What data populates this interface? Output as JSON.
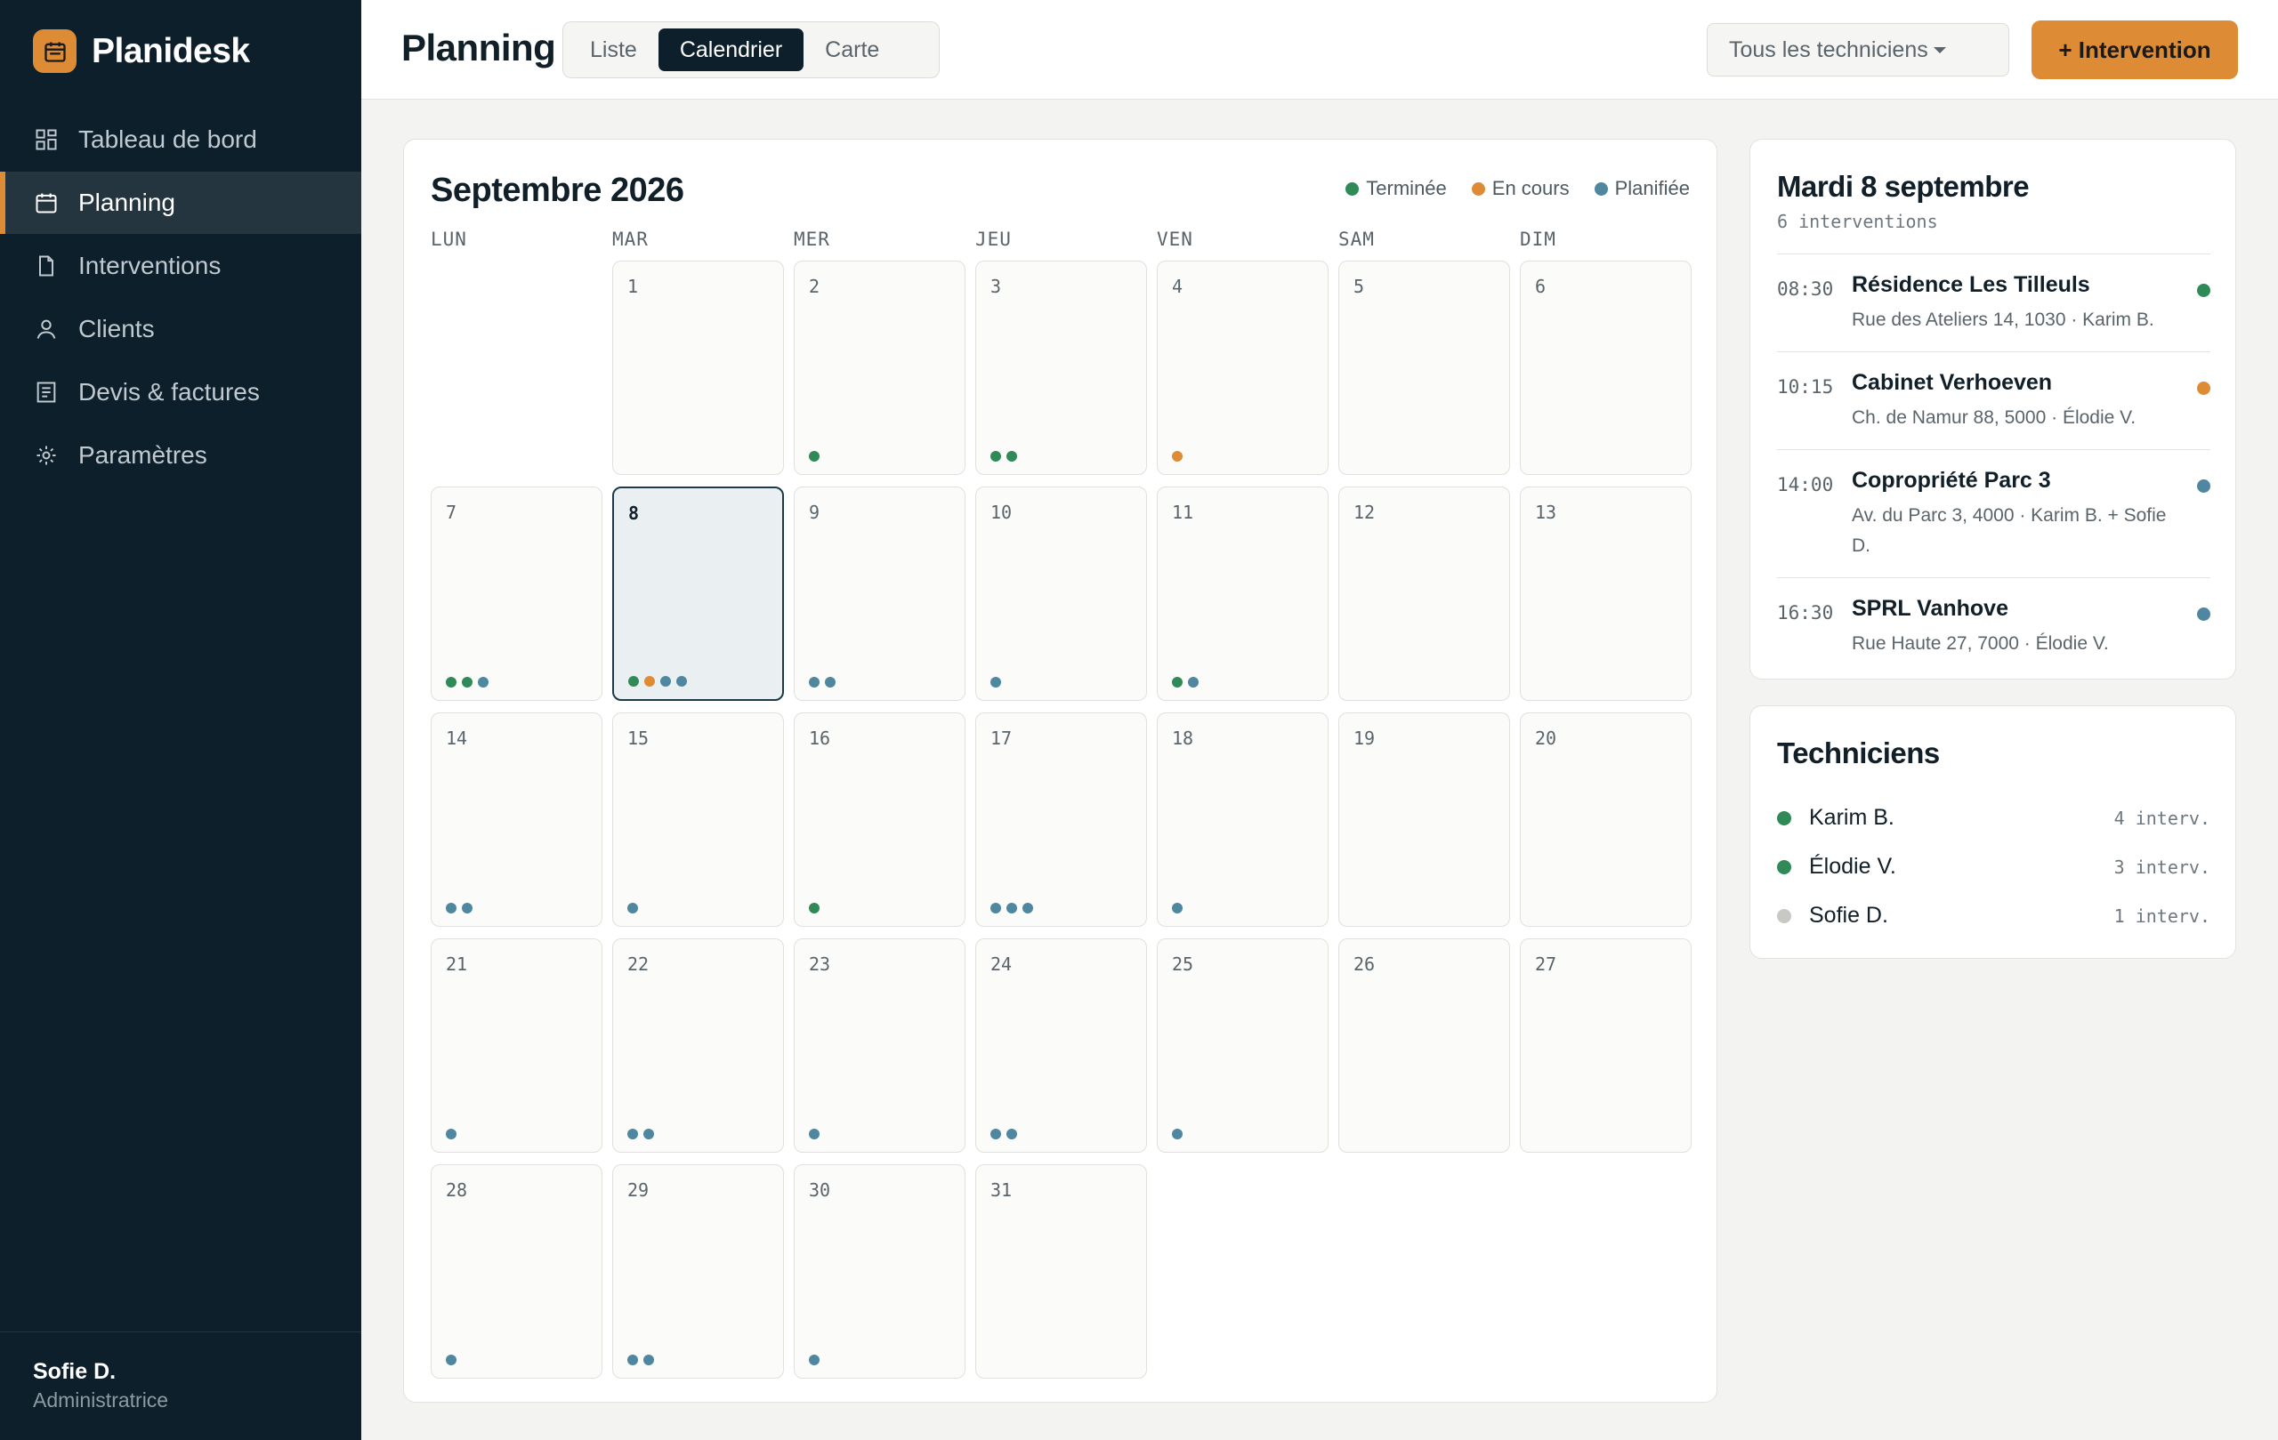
{
  "app": {
    "name": "Planidesk",
    "logo_icon": "calendar-icon",
    "accent": "#de8b35",
    "sidebar_bg": "#0d1f2b"
  },
  "sidebar": {
    "items": [
      {
        "label": "Tableau de bord",
        "icon": "dashboard-icon",
        "active": false
      },
      {
        "label": "Planning",
        "icon": "calendar-icon",
        "active": true
      },
      {
        "label": "Interventions",
        "icon": "document-icon",
        "active": false
      },
      {
        "label": "Clients",
        "icon": "user-icon",
        "active": false
      },
      {
        "label": "Devis & factures",
        "icon": "invoice-icon",
        "active": false
      },
      {
        "label": "Paramètres",
        "icon": "settings-icon",
        "active": false
      }
    ],
    "user": {
      "name": "Sofie D.",
      "role": "Administratrice"
    }
  },
  "topbar": {
    "title": "Planning",
    "views": [
      {
        "label": "Liste",
        "active": false
      },
      {
        "label": "Calendrier",
        "active": true
      },
      {
        "label": "Carte",
        "active": false
      }
    ],
    "filter_label": "Tous les techniciens",
    "add_button_label": "+ Intervention"
  },
  "status_colors": {
    "done": "#2f8a57",
    "progress": "#de8b35",
    "planned": "#4f86a0",
    "inactive": "#c8c8c4"
  },
  "calendar": {
    "month_title": "Septembre 2026",
    "legend": [
      {
        "label": "Terminée",
        "status": "done"
      },
      {
        "label": "En cours",
        "status": "progress"
      },
      {
        "label": "Planifiée",
        "status": "planned"
      }
    ],
    "weekdays": [
      "LUN",
      "MAR",
      "MER",
      "JEU",
      "VEN",
      "SAM",
      "DIM"
    ],
    "first_weekday_index": 1,
    "selected_day": 8,
    "days": [
      {
        "day": 1,
        "dots": []
      },
      {
        "day": 2,
        "dots": [
          "done"
        ]
      },
      {
        "day": 3,
        "dots": [
          "done",
          "done"
        ]
      },
      {
        "day": 4,
        "dots": [
          "progress"
        ]
      },
      {
        "day": 5,
        "dots": []
      },
      {
        "day": 6,
        "dots": []
      },
      {
        "day": 7,
        "dots": [
          "done",
          "done",
          "planned"
        ]
      },
      {
        "day": 8,
        "dots": [
          "done",
          "progress",
          "planned",
          "planned"
        ]
      },
      {
        "day": 9,
        "dots": [
          "planned",
          "planned"
        ]
      },
      {
        "day": 10,
        "dots": [
          "planned"
        ]
      },
      {
        "day": 11,
        "dots": [
          "done",
          "planned"
        ]
      },
      {
        "day": 12,
        "dots": []
      },
      {
        "day": 13,
        "dots": []
      },
      {
        "day": 14,
        "dots": [
          "planned",
          "planned"
        ]
      },
      {
        "day": 15,
        "dots": [
          "planned"
        ]
      },
      {
        "day": 16,
        "dots": [
          "done"
        ]
      },
      {
        "day": 17,
        "dots": [
          "planned",
          "planned",
          "planned"
        ]
      },
      {
        "day": 18,
        "dots": [
          "planned"
        ]
      },
      {
        "day": 19,
        "dots": []
      },
      {
        "day": 20,
        "dots": []
      },
      {
        "day": 21,
        "dots": [
          "planned"
        ]
      },
      {
        "day": 22,
        "dots": [
          "planned",
          "planned"
        ]
      },
      {
        "day": 23,
        "dots": [
          "planned"
        ]
      },
      {
        "day": 24,
        "dots": [
          "planned",
          "planned"
        ]
      },
      {
        "day": 25,
        "dots": [
          "planned"
        ]
      },
      {
        "day": 26,
        "dots": []
      },
      {
        "day": 27,
        "dots": []
      },
      {
        "day": 28,
        "dots": [
          "planned"
        ]
      },
      {
        "day": 29,
        "dots": [
          "planned",
          "planned"
        ]
      },
      {
        "day": 30,
        "dots": [
          "planned"
        ]
      },
      {
        "day": 31,
        "dots": []
      }
    ]
  },
  "day_panel": {
    "title": "Mardi 8 septembre",
    "subtitle": "6 interventions",
    "events": [
      {
        "time": "08:30",
        "title": "Résidence Les Tilleuls",
        "meta": "Rue des Ateliers 14, 1030 · Karim B.",
        "status": "done"
      },
      {
        "time": "10:15",
        "title": "Cabinet Verhoeven",
        "meta": "Ch. de Namur 88, 5000 · Élodie V.",
        "status": "progress"
      },
      {
        "time": "14:00",
        "title": "Copropriété Parc 3",
        "meta": "Av. du Parc 3, 4000 · Karim B. + Sofie D.",
        "status": "planned"
      },
      {
        "time": "16:30",
        "title": "SPRL Vanhove",
        "meta": "Rue Haute 27, 7000 · Élodie V.",
        "status": "planned"
      }
    ]
  },
  "technicians": {
    "title": "Techniciens",
    "items": [
      {
        "name": "Karim B.",
        "count": "4 interv.",
        "status": "done"
      },
      {
        "name": "Élodie V.",
        "count": "3 interv.",
        "status": "done"
      },
      {
        "name": "Sofie D.",
        "count": "1 interv.",
        "status": "inactive"
      }
    ]
  }
}
